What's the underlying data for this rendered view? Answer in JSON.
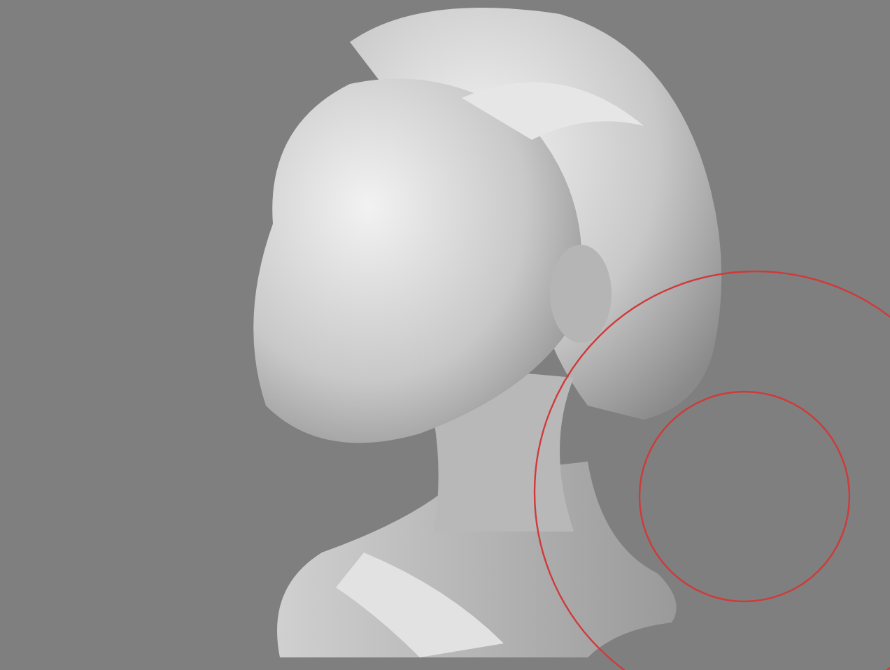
{
  "viewport": {
    "kind": "sculpt",
    "brush_cursor": {
      "color": "#d03a3a"
    }
  }
}
